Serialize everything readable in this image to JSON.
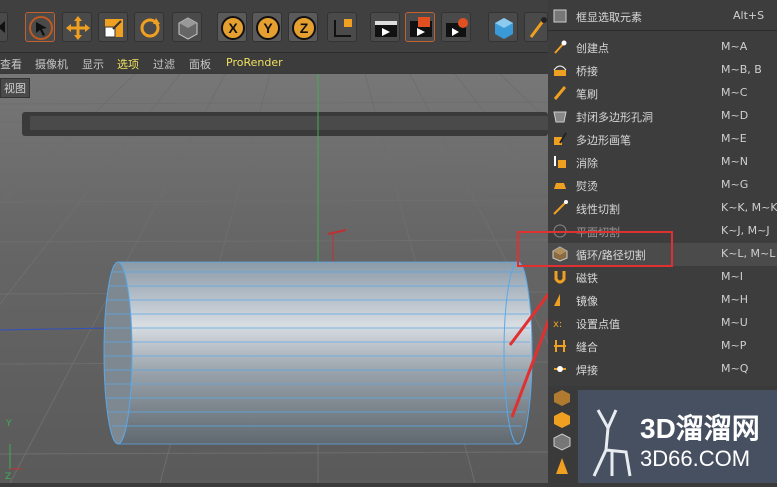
{
  "menu_bar": {
    "items": [
      "查看",
      "摄像机",
      "显示",
      "选项",
      "过滤",
      "面板",
      "ProRender"
    ],
    "active_index": 3
  },
  "viewport": {
    "label": "视图"
  },
  "context_menu": {
    "top_item": {
      "label": "框显选取元素",
      "shortcut": "Alt+S"
    },
    "items": [
      {
        "label": "创建点",
        "shortcut": "M~A",
        "icon": "create-point-icon"
      },
      {
        "label": "桥接",
        "shortcut": "M~B, B",
        "icon": "bridge-icon"
      },
      {
        "label": "笔刷",
        "shortcut": "M~C",
        "icon": "brush-icon"
      },
      {
        "label": "封闭多边形孔洞",
        "shortcut": "M~D",
        "icon": "close-hole-icon"
      },
      {
        "label": "多边形画笔",
        "shortcut": "M~E",
        "icon": "polygon-pen-icon"
      },
      {
        "label": "消除",
        "shortcut": "M~N",
        "icon": "dissolve-icon"
      },
      {
        "label": "熨烫",
        "shortcut": "M~G",
        "icon": "iron-icon"
      },
      {
        "label": "线性切割",
        "shortcut": "K~K, M~K",
        "icon": "line-cut-icon"
      },
      {
        "label": "平面切割",
        "shortcut": "K~J, M~J",
        "icon": "plane-cut-icon"
      },
      {
        "label": "循环/路径切割",
        "shortcut": "K~L, M~L",
        "icon": "loop-cut-icon",
        "highlighted": true
      },
      {
        "label": "磁铁",
        "shortcut": "M~I",
        "icon": "magnet-icon"
      },
      {
        "label": "镜像",
        "shortcut": "M~H",
        "icon": "mirror-icon"
      },
      {
        "label": "设置点值",
        "shortcut": "M~U",
        "icon": "set-point-value-icon"
      },
      {
        "label": "缝合",
        "shortcut": "M~P",
        "icon": "stitch-icon"
      },
      {
        "label": "焊接",
        "shortcut": "M~Q",
        "icon": "weld-icon"
      }
    ]
  },
  "toolbar": {
    "icons": [
      "arrow-left-icon",
      "select-icon",
      "move-icon",
      "scale-icon",
      "rotate-icon",
      "object-icon",
      "x-axis-icon",
      "y-axis-icon",
      "z-axis-icon",
      "coordinate-icon",
      "render-view-icon",
      "render-picture-queue-icon",
      "render-settings-icon",
      "cube-icon",
      "pen-icon"
    ]
  },
  "watermark": {
    "brand": "3D溜溜网",
    "url": "3D66.COM"
  }
}
